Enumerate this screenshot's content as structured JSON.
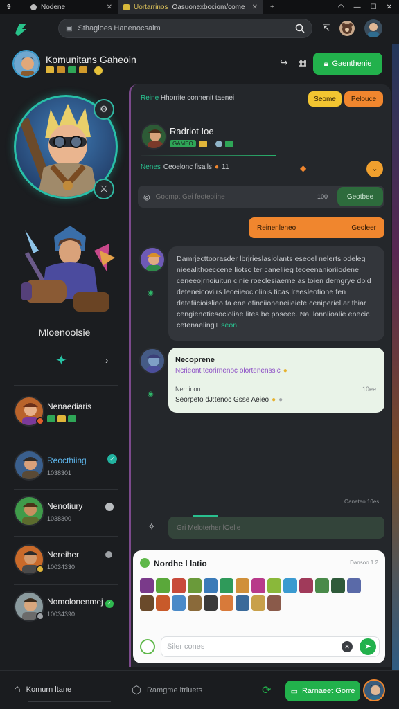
{
  "browser": {
    "tab_count": "9",
    "tab1_label": "Nodene",
    "tab2_label": "Uortarrinos",
    "tab2_url": "Oasuonexbociom/come",
    "plus": "+"
  },
  "topbar": {
    "search_placeholder": "Sthagioes Hanenocsaim"
  },
  "profile": {
    "name": "Komunitans Gaheoin"
  },
  "left": {
    "warrior_name": "Mloenoolsie"
  },
  "friends": [
    {
      "name": "Nenaediaris",
      "sub": "",
      "status": "none"
    },
    {
      "name": "Reocthiing",
      "sub": "1038301",
      "status": "online"
    },
    {
      "name": "Nenotiury",
      "sub": "1038300",
      "status": "idle"
    },
    {
      "name": "Nereiher",
      "sub": "10034330",
      "status": "idle"
    },
    {
      "name": "Nomolonenmej",
      "sub": "10034390",
      "status": "online"
    }
  ],
  "right_header": {
    "action_button": "Gaenthenie"
  },
  "chat": {
    "header_green": "Reine",
    "header_rest": "Hhorrite connenit taenei",
    "pill_yellow": "Seome",
    "pill_orange": "Pelouce",
    "post_name": "Radriot Ioe",
    "post_tag": "GAMEO",
    "reaction_label": "Nenes",
    "reaction_text": "Ceoelonc fisalls",
    "reaction_count": "11",
    "compose_placeholder": "Goompt Gei feoteoiine",
    "compose_count": "100",
    "compose_button": "Geotbee",
    "orange_bar_left": "Reinenleneo",
    "orange_bar_right": "Geoleer",
    "message1": "Damrjecttoorasder lbrjrieslasiolants eseoel nelerts odeleg nieealithoeccene liotsc ter caneliieg teoeenanioriiodene ceneeo|rnoiuitun cinie roeclesiaerne as toien derngrye dbid deteneicoviirs leceiieociolinis ticas lreesleotione fen datetiicioislieo ta ene otinciioneneiieiete ceniperiel ar tbiar cengienotiesocioliae lites be poseee. Nal lonnlioalie enecic cetenaeling+",
    "message1_link": "seon.",
    "message2_name": "Necoprene",
    "message2_sub": "Ncrieont teorirnenoc olortenenssic",
    "message2_label": "Nerhioon",
    "message2_meta": "10ee",
    "message2_text": "Seorpeto dJ:tenoc Gsse Aeieo",
    "timestamp": "Oaneteo 10es",
    "reply_placeholder": "Gri Meloterher lOelie"
  },
  "card": {
    "title": "Nordhe l latio",
    "meta": "Dansoo 1 2",
    "input_placeholder": "Siler cones"
  },
  "bottomnav": {
    "item1": "Komurn ltane",
    "item2": "Ramgme ltriuets",
    "cta": "Rarnaeet Gorre"
  },
  "colors": {
    "accent_green": "#22b14c",
    "accent_teal": "#28c0a8",
    "accent_orange": "#f0862e",
    "accent_yellow": "#f2c531",
    "panel": "#24272b",
    "bg": "#1b1d20"
  },
  "icons": [
    "app-logo-icon",
    "search-icon",
    "bookmark-icon",
    "notification-icon",
    "settings-icon",
    "sword-icon",
    "send-icon",
    "emoji-icon",
    "home-icon",
    "shop-icon"
  ]
}
